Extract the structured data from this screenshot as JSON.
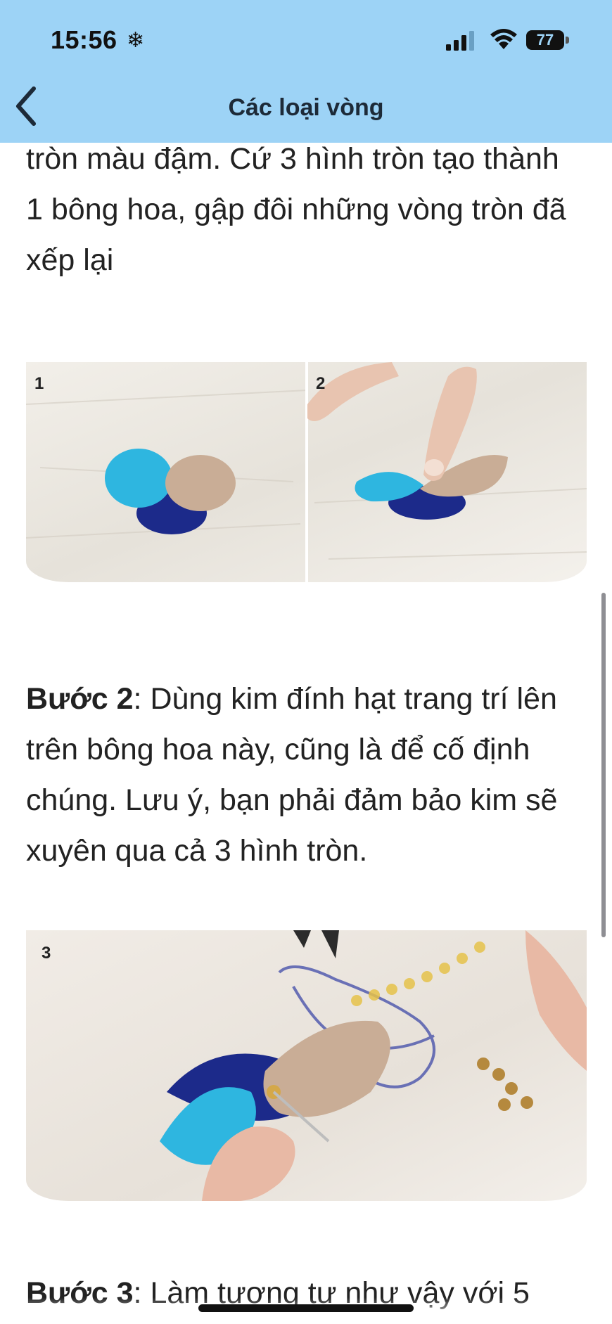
{
  "status_bar": {
    "time": "15:56",
    "battery": "77"
  },
  "nav": {
    "title": "Các loại vòng"
  },
  "article": {
    "para_top": "tròn màu đậm. Cứ 3 hình tròn tạo thành 1 bông hoa, gập đôi những vòng tròn đã xếp lại",
    "image1": {
      "label_left": "1",
      "label_right": "2"
    },
    "step2": {
      "label": "Bước 2",
      "text": ": Dùng kim đính hạt trang trí lên trên bông hoa này, cũng là để cố định chúng. Lưu ý, bạn phải đảm bảo kim sẽ xuyên qua cả 3 hình tròn."
    },
    "image2": {
      "label": "3"
    },
    "step3": {
      "label": "Bước 3",
      "text": ": Làm tương tự như vậy với 5"
    }
  },
  "colors": {
    "header_bg": "#9dd3f6",
    "text": "#222222",
    "felt_blue": "#2eb6e0",
    "felt_tan": "#c9ad96",
    "felt_navy": "#1c2a8a"
  }
}
